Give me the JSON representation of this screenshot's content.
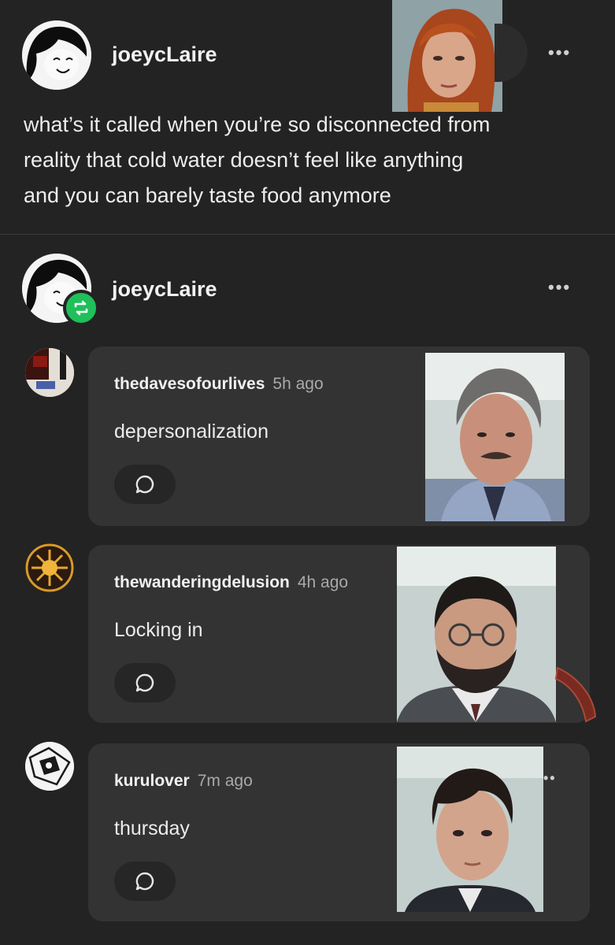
{
  "post": {
    "username": "joeycLaire",
    "more_label": "•••",
    "text_lines": [
      "what’s it called when you’re so disconnected from",
      "reality that cold water doesn’t feel like anything",
      "and you can barely taste food anymore"
    ]
  },
  "reblog": {
    "username": "joeycLaire",
    "more_label": "•••"
  },
  "replies": [
    {
      "username": "thedavesofourlives",
      "time": "5h ago",
      "text": "depersonalization"
    },
    {
      "username": "thewanderingdelusion",
      "time": "4h ago",
      "text": "Locking in"
    },
    {
      "username": "kurulover",
      "time": "7m ago",
      "text": "thursday"
    }
  ],
  "colors": {
    "background": "#232323",
    "card": "#333333",
    "reblog_green": "#1fbf5a"
  }
}
